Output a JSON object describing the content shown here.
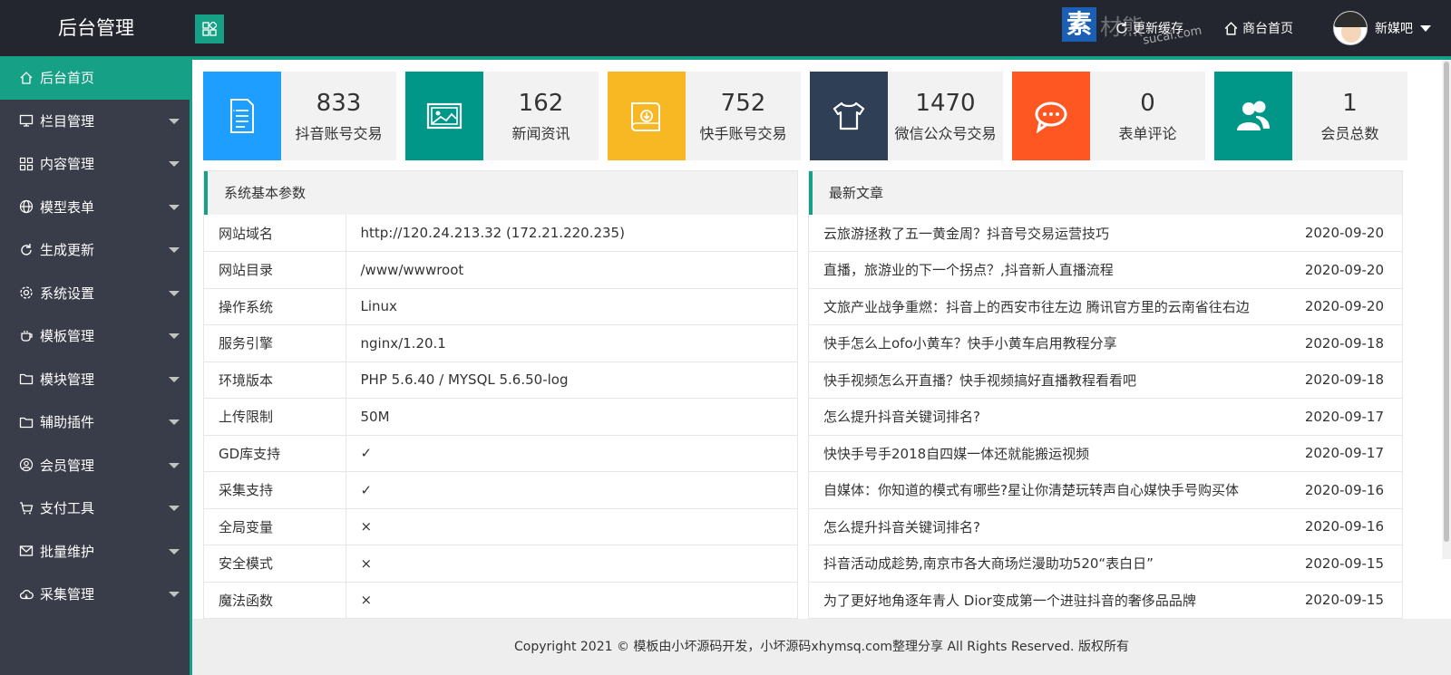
{
  "header": {
    "logo": "后台管理",
    "watermark_char": "素",
    "watermark_text": "材熊",
    "watermark_url": "sucai.com",
    "nav_update": "更新缓存",
    "nav_home": "商台首页",
    "user_name": "新媒吧"
  },
  "sidebar": {
    "items": [
      {
        "label": "后台首页",
        "icon": "home-icon"
      },
      {
        "label": "栏目管理",
        "icon": "monitor-icon"
      },
      {
        "label": "内容管理",
        "icon": "grid-icon"
      },
      {
        "label": "模型表单",
        "icon": "globe-icon"
      },
      {
        "label": "生成更新",
        "icon": "refresh-icon"
      },
      {
        "label": "系统设置",
        "icon": "gear-icon"
      },
      {
        "label": "模板管理",
        "icon": "cup-icon"
      },
      {
        "label": "模块管理",
        "icon": "folder-icon"
      },
      {
        "label": "辅助插件",
        "icon": "folder-icon"
      },
      {
        "label": "会员管理",
        "icon": "user-icon"
      },
      {
        "label": "支付工具",
        "icon": "cart-icon"
      },
      {
        "label": "批量维护",
        "icon": "mail-icon"
      },
      {
        "label": "采集管理",
        "icon": "cloud-icon"
      }
    ]
  },
  "stats": [
    {
      "value": "833",
      "label": "抖音账号交易",
      "color": "#1E9FFF",
      "icon": "document-icon"
    },
    {
      "value": "162",
      "label": "新闻资讯",
      "color": "#009688",
      "icon": "image-icon"
    },
    {
      "value": "752",
      "label": "快手账号交易",
      "color": "#F7B824",
      "icon": "download-folder-icon"
    },
    {
      "value": "1470",
      "label": "微信公众号交易",
      "color": "#2F4056",
      "icon": "shirt-icon"
    },
    {
      "value": "0",
      "label": "表单评论",
      "color": "#FF5722",
      "icon": "chat-icon"
    },
    {
      "value": "1",
      "label": "会员总数",
      "color": "#009688",
      "icon": "users-icon"
    }
  ],
  "params": {
    "title": "系统基本参数",
    "rows": [
      {
        "k": "网站域名",
        "v": "http://120.24.213.32 (172.21.220.235)"
      },
      {
        "k": "网站目录",
        "v": "/www/wwwroot"
      },
      {
        "k": "操作系统",
        "v": "Linux"
      },
      {
        "k": "服务引擎",
        "v": "nginx/1.20.1"
      },
      {
        "k": "环境版本",
        "v": "PHP 5.6.40 / MYSQL 5.6.50-log"
      },
      {
        "k": "上传限制",
        "v": "50M"
      },
      {
        "k": "GD库支持",
        "v": "✓"
      },
      {
        "k": "采集支持",
        "v": "✓"
      },
      {
        "k": "全局变量",
        "v": "×"
      },
      {
        "k": "安全模式",
        "v": "×"
      },
      {
        "k": "魔法函数",
        "v": "×"
      }
    ]
  },
  "articles": {
    "title": "最新文章",
    "rows": [
      {
        "t": "云旅游拯救了五一黄金周？抖音号交易运营技巧",
        "d": "2020-09-20"
      },
      {
        "t": "直播，旅游业的下一个拐点？,抖音新人直播流程",
        "d": "2020-09-20"
      },
      {
        "t": "文旅产业战争重燃：抖音上的西安市往左边 腾讯官方里的云南省往右边",
        "d": "2020-09-20"
      },
      {
        "t": "快手怎么上ofo小黄车？快手小黄车启用教程分享",
        "d": "2020-09-18"
      },
      {
        "t": "快手视频怎么开直播？快手视频搞好直播教程看看吧",
        "d": "2020-09-18"
      },
      {
        "t": "怎么提升抖音关键词排名?",
        "d": "2020-09-17"
      },
      {
        "t": "快快手号手2018自四媒一体还就能搬运视频",
        "d": "2020-09-17"
      },
      {
        "t": "自媒体：你知道的模式有哪些?星让你清楚玩转声自心媒快手号购买体",
        "d": "2020-09-16"
      },
      {
        "t": "怎么提升抖音关键词排名?",
        "d": "2020-09-16"
      },
      {
        "t": "抖音活动成趁势,南京市各大商场烂漫助功520“表白日”",
        "d": "2020-09-15"
      },
      {
        "t": "为了更好地角逐年青人 Dior变成第一个进驻抖音的奢侈品品牌",
        "d": "2020-09-15"
      }
    ]
  },
  "footer": {
    "text": "Copyright 2021 © 模板由小坏源码开发，小坏源码xhymsq.com整理分享 All Rights Reserved. 版权所有"
  }
}
